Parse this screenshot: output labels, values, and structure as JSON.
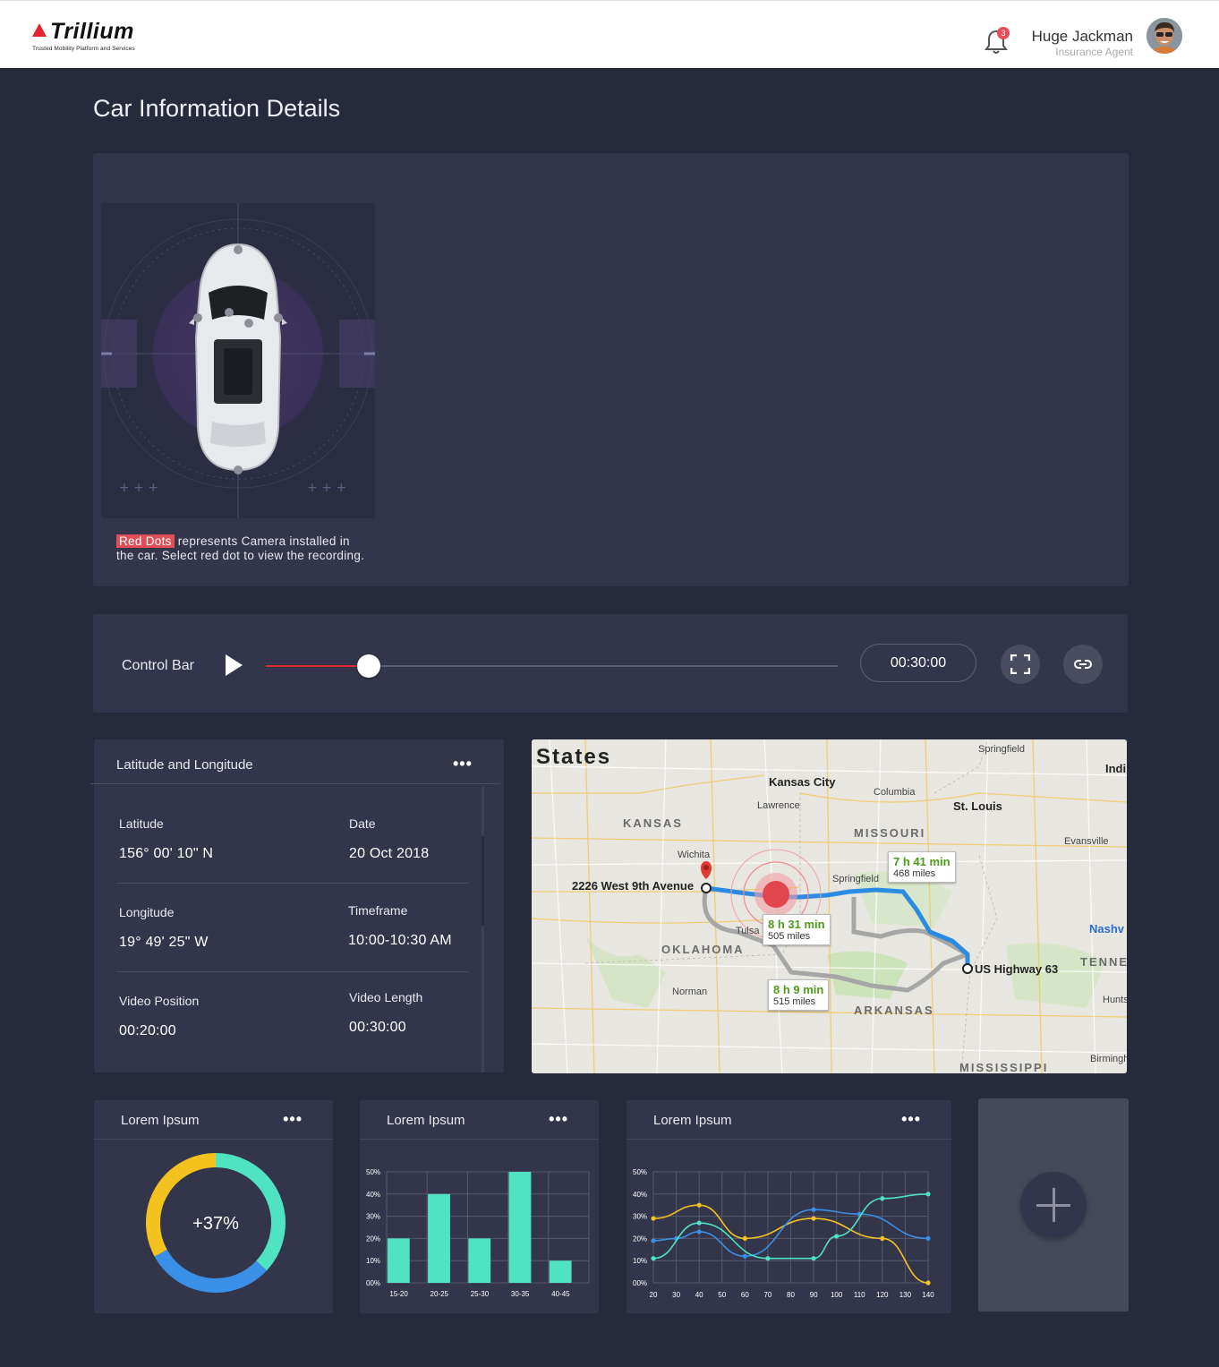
{
  "header": {
    "brand": "Trillium",
    "tagline": "Trusted Mobility Platform and Services",
    "notifications": "3",
    "user_name": "Huge Jackman",
    "user_role": "Insurance Agent"
  },
  "page_title": "Car Information Details",
  "camera": {
    "highlight": "Red Dots",
    "note": " represents Camera installed in the car. Select red dot to view the recording."
  },
  "control_bar": {
    "label": "Control Bar",
    "progress": 0.18,
    "time": "00:30:00"
  },
  "latlong": {
    "title": "Latitude and Longitude",
    "latitude_label": "Latitude",
    "latitude": "156° 00' 10\" N",
    "date_label": "Date",
    "date": "20 Oct 2018",
    "longitude_label": "Longitude",
    "longitude": "19° 49' 25\" W",
    "timeframe_label": "Timeframe",
    "timeframe": "10:00-10:30 AM",
    "video_position_label": "Video Position",
    "video_position": "00:20:00",
    "video_length_label": "Video Length",
    "video_length": "00:30:00"
  },
  "map": {
    "header": "States",
    "origin": "2226 West 9th Avenue",
    "destination": "US Highway 63",
    "states": [
      "KANSAS",
      "MISSOURI",
      "OKLAHOMA",
      "ARKANSAS",
      "MISSISSIPPI",
      "TENNE"
    ],
    "cities": [
      "Kansas City",
      "St. Louis",
      "Nashv",
      "Indi"
    ],
    "towns": [
      "Lawrence",
      "Columbia",
      "Springfield",
      "Springfield",
      "Evansville",
      "Wichita",
      "Tulsa",
      "Norman",
      "Hunts",
      "Birmingh"
    ],
    "routes": [
      {
        "time": "7 h 41 min",
        "miles": "468 miles"
      },
      {
        "time": "8 h 31 min",
        "miles": "505 miles"
      },
      {
        "time": "8 h 9 min",
        "miles": "515 miles"
      }
    ]
  },
  "widgets": [
    {
      "title": "Lorem Ipsum"
    },
    {
      "title": "Lorem Ipsum"
    },
    {
      "title": "Lorem Ipsum"
    }
  ],
  "colors": {
    "accent": "#e02a32",
    "teal": "#4fe3c1",
    "blue": "#3a8fe6",
    "yellow": "#f3c21f"
  },
  "chart_data": [
    {
      "type": "pie",
      "title": "Lorem Ipsum",
      "center_label": "+37%",
      "values": [
        37,
        30,
        33
      ],
      "colors": [
        "#4fe3c1",
        "#3a8fe6",
        "#f3c21f"
      ]
    },
    {
      "type": "bar",
      "title": "Lorem Ipsum",
      "categories": [
        "15-20",
        "20-25",
        "25-30",
        "30-35",
        "40-45"
      ],
      "values": [
        20,
        40,
        20,
        50,
        10
      ],
      "ylim": [
        0,
        50
      ],
      "yticks": [
        "00%",
        "10%",
        "20%",
        "30%",
        "40%",
        "50%"
      ],
      "color": "#4fe3c1"
    },
    {
      "type": "line",
      "title": "Lorem Ipsum",
      "x": [
        20,
        30,
        40,
        50,
        60,
        70,
        80,
        90,
        100,
        110,
        120,
        130,
        140
      ],
      "xticks": [
        "20",
        "30",
        "40",
        "50",
        "60",
        "70",
        "80",
        "90",
        "100",
        "110",
        "120",
        "130",
        "140"
      ],
      "yticks": [
        "00%",
        "10%",
        "20%",
        "30%",
        "40%",
        "50%"
      ],
      "ylim": [
        0,
        50
      ],
      "series": [
        {
          "color": "#f3c21f",
          "points": [
            [
              20,
              29
            ],
            [
              40,
              35
            ],
            [
              60,
              20
            ],
            [
              90,
              29
            ],
            [
              120,
              20
            ],
            [
              140,
              0
            ]
          ]
        },
        {
          "color": "#3a8fe6",
          "points": [
            [
              20,
              19
            ],
            [
              30,
              20
            ],
            [
              40,
              23
            ],
            [
              60,
              12
            ],
            [
              90,
              33
            ],
            [
              110,
              31
            ],
            [
              140,
              20
            ]
          ]
        },
        {
          "color": "#4fe3c1",
          "points": [
            [
              20,
              11
            ],
            [
              40,
              27
            ],
            [
              70,
              11
            ],
            [
              90,
              11
            ],
            [
              100,
              21
            ],
            [
              120,
              38
            ],
            [
              140,
              40
            ]
          ]
        }
      ]
    }
  ]
}
